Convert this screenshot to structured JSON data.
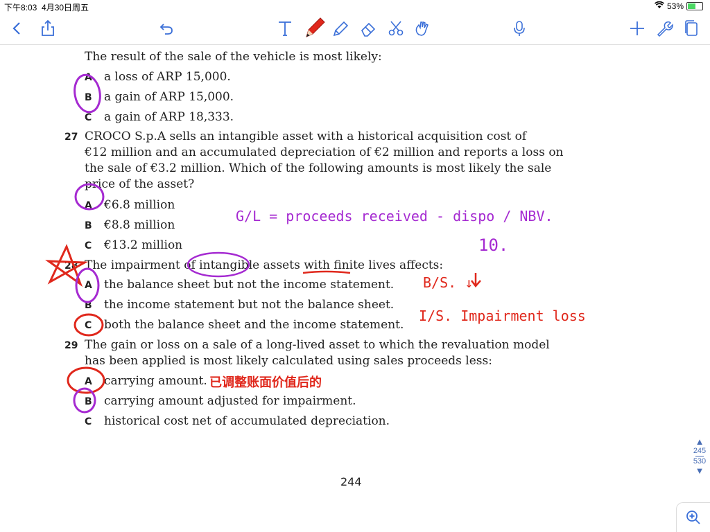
{
  "status_bar": {
    "time": "下午8:03",
    "date": "4月30日周五",
    "battery": "53%",
    "battery_level": 0.53
  },
  "toolbar": {
    "icons": [
      "back-icon",
      "share-icon",
      "undo-icon",
      "text-tool-icon",
      "pen-icon",
      "highlighter-icon",
      "eraser-icon",
      "scissors-icon",
      "lasso-hand-icon",
      "microphone-icon",
      "add-icon",
      "wrench-icon",
      "page-icon"
    ],
    "pen_color": "#e0281c",
    "accent": "#3a6fd8"
  },
  "document": {
    "lines": [
      "The result of the sale of the vehicle is most likely:",
      "a loss of ARP 15,000.",
      "a gain of ARP 15,000.",
      "a gain of ARP 18,333.",
      "CROCO S.p.A sells an intangible asset with a historical acquisition cost of",
      "€12 million and an accumulated depreciation of €2 million and reports a loss on",
      "the sale of €3.2 million. Which of the following amounts is most likely the sale",
      "price of the asset?",
      "€6.8 million",
      "€8.8 million",
      "€13.2 million",
      "The impairment of intangible assets with finite lives affects:",
      "the balance sheet but not the income statement.",
      "the income statement but not the balance sheet.",
      "both the balance sheet and the income statement.",
      "The gain or loss on a sale of a long-lived asset to which the revaluation model",
      "has been applied is most likely calculated using sales proceeds less:",
      "carrying amount.",
      "carrying amount adjusted for impairment.",
      "historical cost net of accumulated depreciation."
    ],
    "question_numbers": [
      "27",
      "28",
      "29"
    ],
    "option_letters": [
      "A",
      "B",
      "C",
      "A",
      "B",
      "C",
      "A",
      "B",
      "C",
      "A",
      "B",
      "C"
    ],
    "page_number": "244"
  },
  "annotations": {
    "formula": "G/L = proceeds received - dispo / NBV.",
    "value": "10.",
    "bs": "B/S. ↓",
    "is": "I/S. Impairment loss",
    "cn_note": "已调整账面价值后的"
  },
  "scroll": {
    "current": "245",
    "total": "530"
  }
}
